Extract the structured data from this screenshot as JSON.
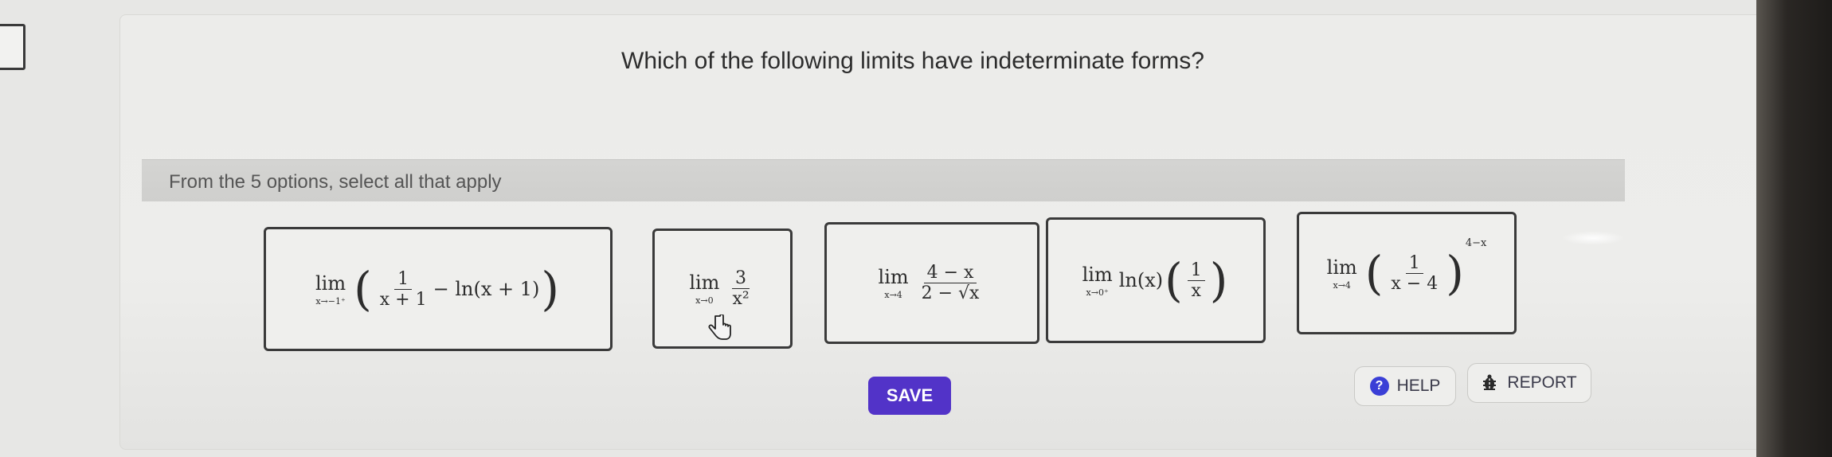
{
  "question": "Which of the following limits have indeterminate forms?",
  "instruction": "From the 5 options, select all that apply",
  "options": [
    {
      "lim": "lim",
      "sub": "x→−1⁺",
      "num": "1",
      "den": "x + 1",
      "tail": "− ln(x + 1)"
    },
    {
      "lim": "lim",
      "sub": "x→0",
      "num": "3",
      "den": "x²"
    },
    {
      "lim": "lim",
      "sub": "x→4",
      "num": "4 − x",
      "den": "2 − √x"
    },
    {
      "lim": "lim",
      "sub": "x→0⁺",
      "pre": "ln(x)",
      "num": "1",
      "den": "x"
    },
    {
      "lim": "lim",
      "sub": "x→4",
      "num": "1",
      "den": "x − 4",
      "exp": "4−x"
    }
  ],
  "buttons": {
    "save": "SAVE",
    "help": "HELP",
    "report": "REPORT"
  },
  "icons": {
    "help": "question-circle-icon",
    "report": "bug-icon",
    "cursor": "hand-pointer-icon"
  },
  "colors": {
    "save_bg": "#5233c8",
    "help_icon": "#3a3fd6"
  }
}
